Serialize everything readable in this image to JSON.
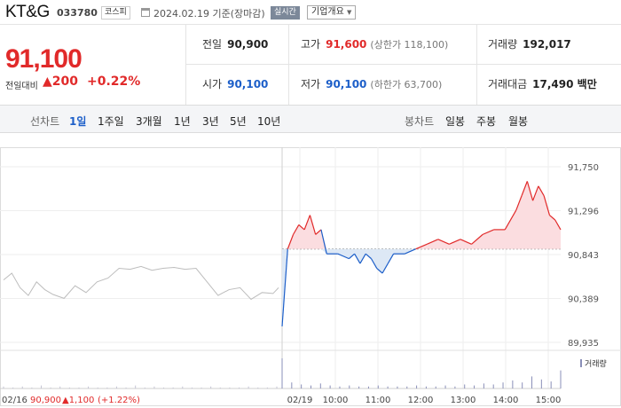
{
  "header": {
    "company": "KT&G",
    "code": "033780",
    "market": "코스피",
    "date": "2024.02.19 기준(장마감)",
    "realtime": "실시간",
    "overview": "기업개요"
  },
  "quote": {
    "price": "91,100",
    "change_label": "전일대비",
    "change_value": "▲200",
    "change_pct": "+0.22%"
  },
  "stats": {
    "prev_close": {
      "label": "전일",
      "value": "90,900"
    },
    "high": {
      "label": "고가",
      "value": "91,600",
      "sub": "(상한가 118,100)"
    },
    "volume": {
      "label": "거래량",
      "value": "192,017"
    },
    "open": {
      "label": "시가",
      "value": "90,100"
    },
    "low": {
      "label": "저가",
      "value": "90,100",
      "sub": "(하한가 63,700)"
    },
    "amount": {
      "label": "거래대금",
      "value": "17,490 백만"
    }
  },
  "tabs": {
    "line_label": "선차트",
    "line_items": [
      "1일",
      "1주일",
      "3개월",
      "1년",
      "3년",
      "5년",
      "10년"
    ],
    "candle_label": "봉차트",
    "candle_items": [
      "일봉",
      "주봉",
      "월봉"
    ]
  },
  "chart_data": {
    "type": "line",
    "ylim": [
      89935,
      91750
    ],
    "y_ticks": [
      "91,750",
      "91,296",
      "90,843",
      "90,389",
      "89,935"
    ],
    "x_ticks": [
      "02/19",
      "10:00",
      "11:00",
      "12:00",
      "13:00",
      "14:00",
      "15:00"
    ],
    "baseline": 90900,
    "prev_day_label": "02/16",
    "prev_day_price": "90,900",
    "prev_day_change": "▲1,100",
    "prev_day_pct": "(+1.22%)",
    "volume_label": "거래량",
    "prev_day_series": [
      {
        "t": 0,
        "v": 90580
      },
      {
        "t": 0.03,
        "v": 90650
      },
      {
        "t": 0.06,
        "v": 90500
      },
      {
        "t": 0.09,
        "v": 90420
      },
      {
        "t": 0.12,
        "v": 90560
      },
      {
        "t": 0.15,
        "v": 90480
      },
      {
        "t": 0.18,
        "v": 90430
      },
      {
        "t": 0.22,
        "v": 90390
      },
      {
        "t": 0.26,
        "v": 90520
      },
      {
        "t": 0.3,
        "v": 90450
      },
      {
        "t": 0.34,
        "v": 90560
      },
      {
        "t": 0.38,
        "v": 90600
      },
      {
        "t": 0.42,
        "v": 90700
      },
      {
        "t": 0.46,
        "v": 90690
      },
      {
        "t": 0.5,
        "v": 90720
      },
      {
        "t": 0.54,
        "v": 90680
      },
      {
        "t": 0.58,
        "v": 90700
      },
      {
        "t": 0.62,
        "v": 90710
      },
      {
        "t": 0.66,
        "v": 90690
      },
      {
        "t": 0.7,
        "v": 90700
      },
      {
        "t": 0.74,
        "v": 90560
      },
      {
        "t": 0.78,
        "v": 90420
      },
      {
        "t": 0.82,
        "v": 90480
      },
      {
        "t": 0.86,
        "v": 90500
      },
      {
        "t": 0.9,
        "v": 90380
      },
      {
        "t": 0.94,
        "v": 90450
      },
      {
        "t": 0.98,
        "v": 90440
      },
      {
        "t": 1.0,
        "v": 90500
      }
    ],
    "today_series": [
      {
        "t": 0,
        "v": 90100
      },
      {
        "t": 0.02,
        "v": 90900
      },
      {
        "t": 0.04,
        "v": 91050
      },
      {
        "t": 0.06,
        "v": 91150
      },
      {
        "t": 0.08,
        "v": 91100
      },
      {
        "t": 0.1,
        "v": 91250
      },
      {
        "t": 0.12,
        "v": 91050
      },
      {
        "t": 0.14,
        "v": 91100
      },
      {
        "t": 0.16,
        "v": 90850
      },
      {
        "t": 0.2,
        "v": 90850
      },
      {
        "t": 0.24,
        "v": 90800
      },
      {
        "t": 0.26,
        "v": 90850
      },
      {
        "t": 0.28,
        "v": 90750
      },
      {
        "t": 0.3,
        "v": 90850
      },
      {
        "t": 0.32,
        "v": 90800
      },
      {
        "t": 0.34,
        "v": 90700
      },
      {
        "t": 0.36,
        "v": 90650
      },
      {
        "t": 0.38,
        "v": 90750
      },
      {
        "t": 0.4,
        "v": 90850
      },
      {
        "t": 0.44,
        "v": 90850
      },
      {
        "t": 0.48,
        "v": 90900
      },
      {
        "t": 0.52,
        "v": 90950
      },
      {
        "t": 0.56,
        "v": 91000
      },
      {
        "t": 0.6,
        "v": 90950
      },
      {
        "t": 0.64,
        "v": 91000
      },
      {
        "t": 0.68,
        "v": 90950
      },
      {
        "t": 0.72,
        "v": 91050
      },
      {
        "t": 0.76,
        "v": 91100
      },
      {
        "t": 0.8,
        "v": 91100
      },
      {
        "t": 0.84,
        "v": 91300
      },
      {
        "t": 0.86,
        "v": 91450
      },
      {
        "t": 0.88,
        "v": 91600
      },
      {
        "t": 0.9,
        "v": 91400
      },
      {
        "t": 0.92,
        "v": 91550
      },
      {
        "t": 0.94,
        "v": 91450
      },
      {
        "t": 0.96,
        "v": 91250
      },
      {
        "t": 0.98,
        "v": 91200
      },
      {
        "t": 1.0,
        "v": 91100
      }
    ],
    "volume_series": [
      2,
      1,
      2,
      1,
      3,
      1,
      2,
      1,
      1,
      2,
      1,
      1,
      2,
      1,
      3,
      1,
      2,
      1,
      1,
      2,
      1,
      1,
      2,
      1,
      1,
      1,
      2,
      1,
      1,
      2,
      30,
      6,
      4,
      3,
      5,
      3,
      2,
      3,
      2,
      2,
      3,
      2,
      2,
      2,
      3,
      2,
      2,
      3,
      2,
      4,
      3,
      5,
      4,
      6,
      8,
      6,
      12,
      9,
      7,
      18
    ]
  },
  "colors": {
    "up": "#e12a2a",
    "down": "#1d5fc9",
    "up_fill": "#fbdde0",
    "down_fill": "#dde8f5",
    "prev_line": "#bdbdbd",
    "grid": "#eeeeee"
  }
}
